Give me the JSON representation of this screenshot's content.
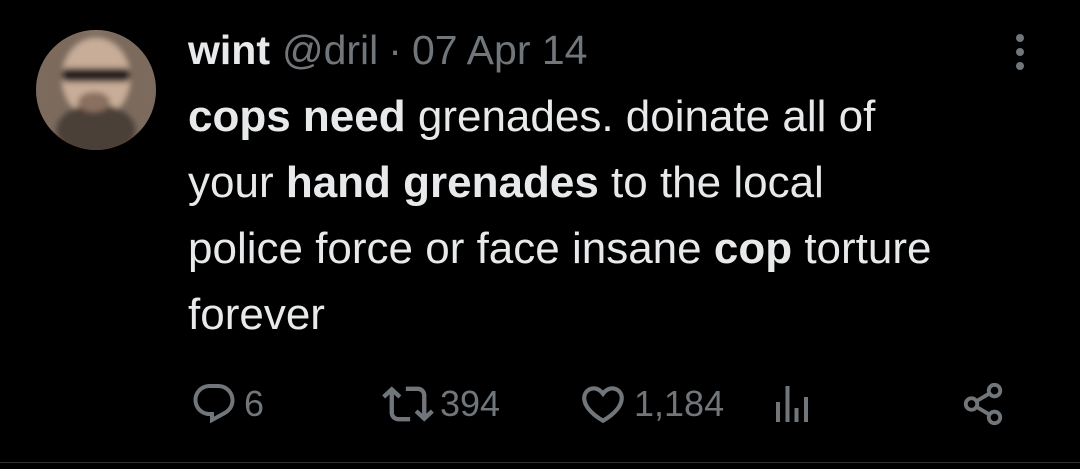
{
  "tweet": {
    "author": {
      "display_name": "wint",
      "handle": "@dril"
    },
    "separator": "·",
    "timestamp": "07 Apr 14",
    "text_lines": [
      [
        {
          "text": "cops need",
          "bold": true
        },
        {
          "text": " grenades. doinate all of",
          "bold": false
        }
      ],
      [
        {
          "text": "your ",
          "bold": false
        },
        {
          "text": "hand grenades",
          "bold": true
        },
        {
          "text": " to the local",
          "bold": false
        }
      ],
      [
        {
          "text": "police force or face insane ",
          "bold": false
        },
        {
          "text": "cop",
          "bold": true
        },
        {
          "text": " torture",
          "bold": false
        }
      ],
      [
        {
          "text": "forever",
          "bold": false
        }
      ]
    ],
    "metrics": {
      "replies": "6",
      "retweets": "394",
      "likes": "1,184"
    }
  },
  "icons": {
    "more": "more-vertical-icon",
    "reply": "reply-bubble-icon",
    "retweet": "retweet-icon",
    "like": "heart-icon",
    "views": "views-chart-icon",
    "share": "share-icon"
  },
  "colors": {
    "background": "#000000",
    "text_primary": "#e7e9ea",
    "text_secondary": "#71767b",
    "divider": "#2f3336"
  }
}
